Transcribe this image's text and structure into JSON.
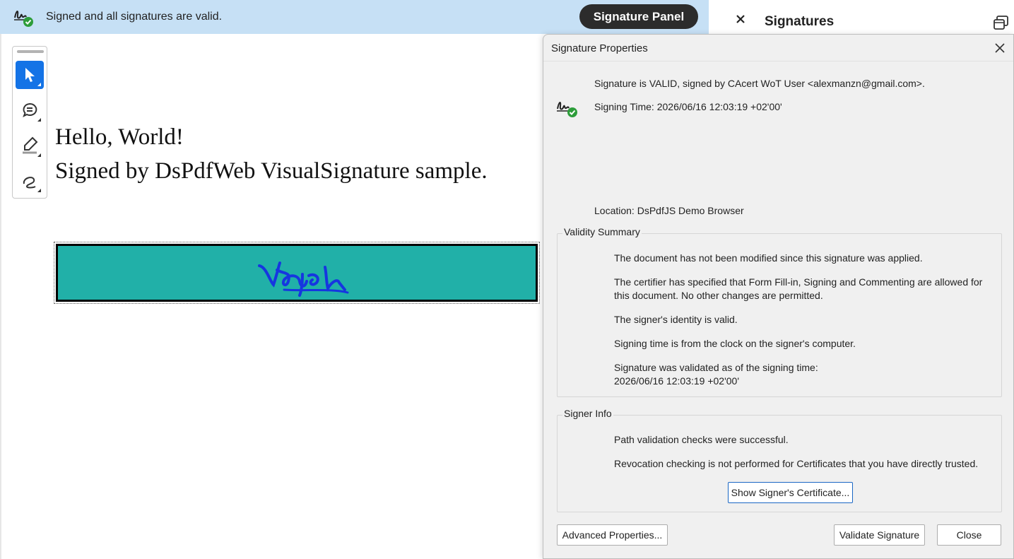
{
  "sigbar": {
    "status_text": "Signed and all signatures are valid.",
    "panel_button": "Signature Panel"
  },
  "right_panel": {
    "title": "Signatures"
  },
  "document": {
    "line1": "Hello, World!",
    "line2": "Signed by DsPdfWeb VisualSignature sample."
  },
  "tools": [
    "select-tool",
    "comment-tool",
    "highlight-tool",
    "draw-tool"
  ],
  "dialog": {
    "title": "Signature Properties",
    "status": "Signature is VALID, signed by CAcert WoT User <alexmanzn@gmail.com>.",
    "signing_time": "Signing Time:  2026/06/16 12:03:19 +02'00'",
    "location": "Location:  DsPdfJS Demo Browser",
    "validity": {
      "legend": "Validity Summary",
      "items": [
        "The document has not been modified since this signature was applied.",
        "The certifier has specified that Form Fill-in, Signing and Commenting are allowed for this document. No other changes are permitted.",
        "The signer's identity is valid.",
        "Signing time is from the clock on the signer's computer.",
        "Signature was validated as of the signing time:\n2026/06/16 12:03:19 +02'00'"
      ]
    },
    "signer_info": {
      "legend": "Signer Info",
      "items": [
        "Path validation checks were successful.",
        "Revocation checking is not performed for Certificates that you have directly trusted."
      ],
      "certificate_button": "Show Signer's Certificate..."
    },
    "buttons": {
      "advanced": "Advanced Properties...",
      "validate": "Validate Signature",
      "close": "Close"
    }
  },
  "colors": {
    "sigbar_bg": "#c6e0f5",
    "signature_field_bg": "#21b0a8",
    "active_tool": "#1473e6",
    "valid_check": "#2d9d3a"
  }
}
